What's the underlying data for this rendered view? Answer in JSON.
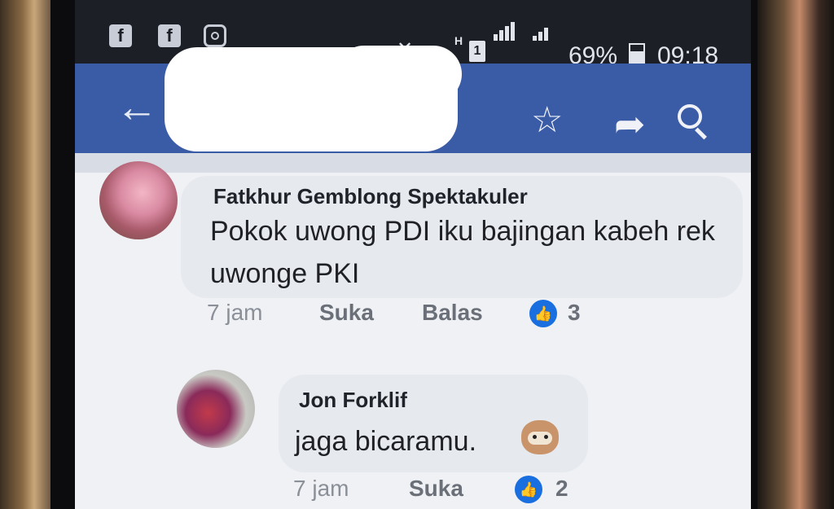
{
  "status_bar": {
    "notification_icons": [
      "facebook-icon",
      "facebook-icon",
      "instagram-icon"
    ],
    "network_type": "H",
    "sim_slot": "1",
    "battery_percent": "69%",
    "time": "09:18"
  },
  "app_bar": {
    "back_icon": "back-arrow-icon",
    "title": "",
    "actions": [
      "star-icon",
      "share-icon",
      "search-icon"
    ]
  },
  "comments": [
    {
      "author": "Fatkhur Gemblong Spektakuler",
      "text": "Pokok uwong PDI iku bajingan kabeh rek uwonge PKI",
      "time": "7 jam",
      "like_label": "Suka",
      "reply_label": "Balas",
      "reactions": "3"
    },
    {
      "author": "Jon Forklif",
      "text": "jaga bicaramu.",
      "emoji": "dog-emoji",
      "time": "7 jam",
      "like_label": "Suka",
      "reactions": "2"
    }
  ],
  "colors": {
    "app_bar": "#3a5ba6",
    "status_bar": "#1d1f26",
    "bubble": "#e6e9ee",
    "like_badge": "#1a6fe0"
  }
}
